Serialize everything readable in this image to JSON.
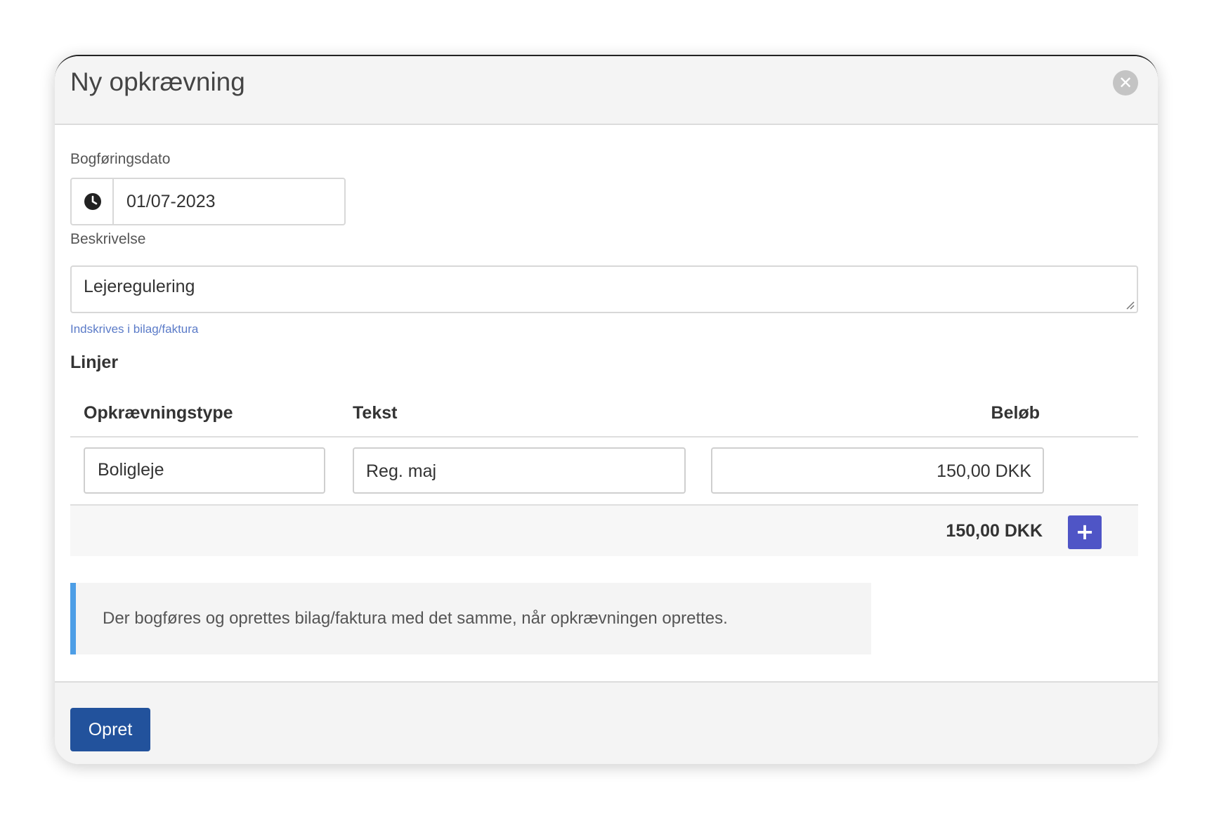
{
  "dialog": {
    "title": "Ny opkrævning",
    "close_icon": "close-icon",
    "close_glyph": "✕"
  },
  "form": {
    "date_label": "Bogføringsdato",
    "date_value": "01/07-2023",
    "date_icon": "clock-icon",
    "description_label": "Beskrivelse",
    "description_value": "Lejeregulering",
    "description_help": "Indskrives i bilag/faktura"
  },
  "lines": {
    "section_title": "Linjer",
    "columns": [
      "Opkrævningstype",
      "Tekst",
      "Beløb"
    ],
    "rows": [
      {
        "type": "Boligleje",
        "text": "Reg. maj",
        "amount": "150,00 DKK"
      }
    ],
    "total": "150,00 DKK",
    "add_icon": "plus-icon",
    "add_glyph": "+"
  },
  "info": {
    "message": "Der bogføres og oprettes bilag/faktura med det samme, når opkrævningen oprettes."
  },
  "footer": {
    "submit_label": "Opret"
  },
  "colors": {
    "primary": "#22529c",
    "add_button": "#4f55c6",
    "info_accent": "#4d9ee6",
    "help_text": "#5b7bc8"
  }
}
